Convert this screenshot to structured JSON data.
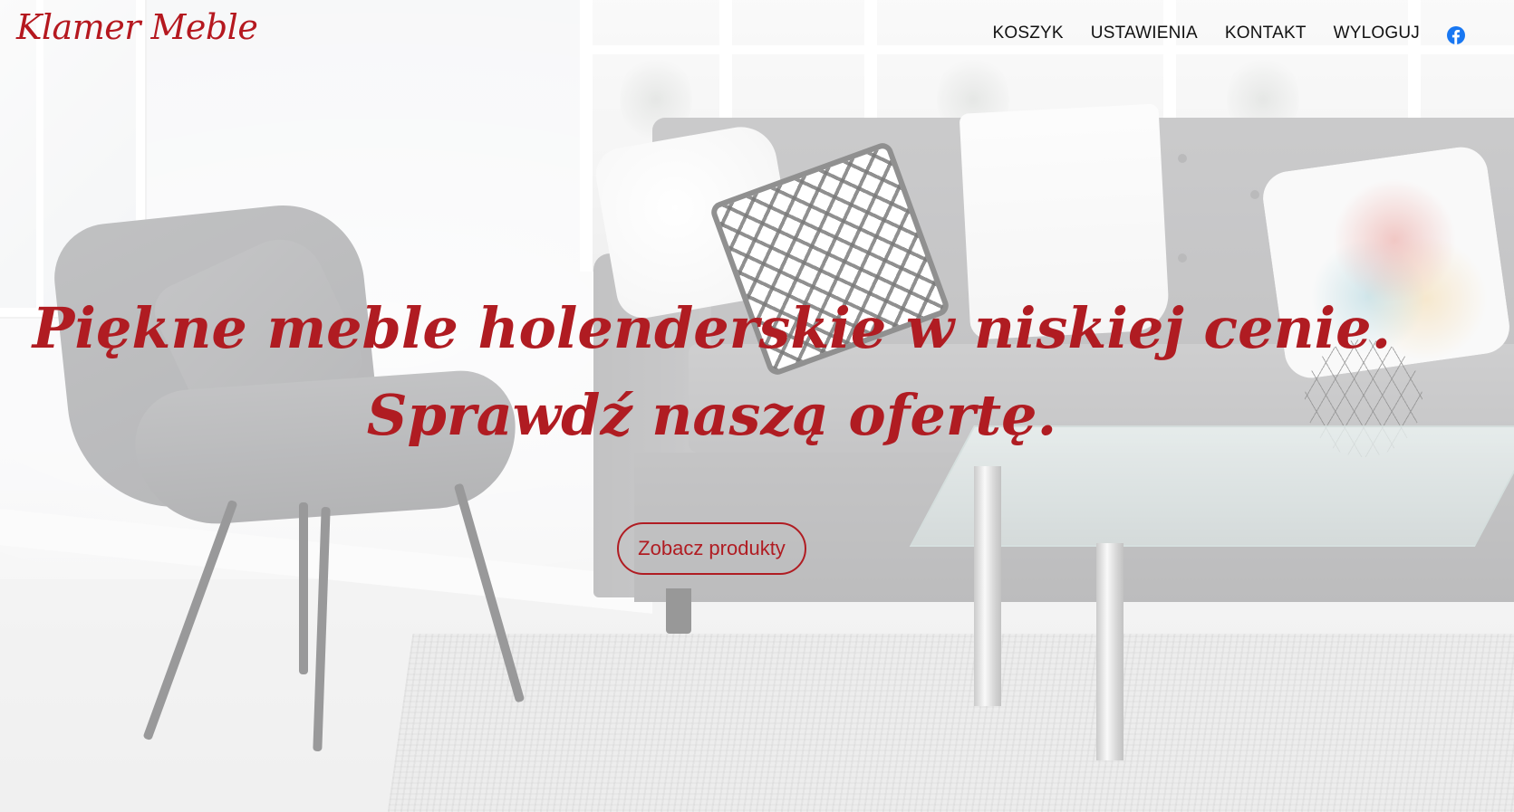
{
  "brand": {
    "name": "Klamer Meble",
    "color": "#b5181f"
  },
  "nav": {
    "items": [
      {
        "label": "KOSZYK"
      },
      {
        "label": "USTAWIENIA"
      },
      {
        "label": "KONTAKT"
      },
      {
        "label": "WYLOGUJ"
      }
    ],
    "social_icon": "facebook-icon",
    "social_color": "#1877f2"
  },
  "hero": {
    "headline_line1": "Piękne meble holenderskie w niskiej cenie.",
    "headline_line2": "Sprawdź naszą ofertę.",
    "cta_label": "Zobacz produkty",
    "accent_color": "#b01c22",
    "background_image": "living-room-sofa-armchair-glass-table"
  }
}
